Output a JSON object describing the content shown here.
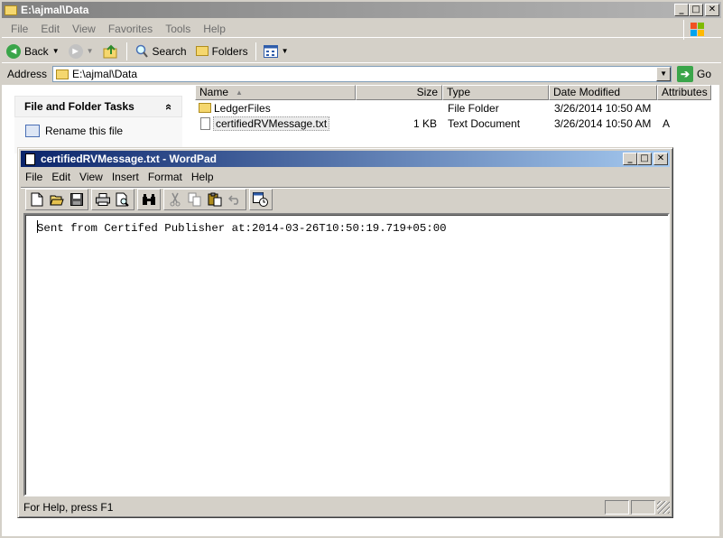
{
  "explorer": {
    "title": "E:\\ajmal\\Data",
    "window_buttons": [
      "_",
      "□",
      "✕"
    ],
    "menu": [
      "File",
      "Edit",
      "View",
      "Favorites",
      "Tools",
      "Help"
    ],
    "toolbar": {
      "back": "Back",
      "search": "Search",
      "folders": "Folders"
    },
    "address": {
      "label": "Address",
      "value": "E:\\ajmal\\Data",
      "go": "Go"
    },
    "tasks": {
      "header": "File and Folder Tasks",
      "collapse": "«",
      "rename": "Rename this file"
    },
    "columns": [
      "Name",
      "Size",
      "Type",
      "Date Modified",
      "Attributes"
    ],
    "files": [
      {
        "name": "LedgerFiles",
        "size": "",
        "type": "File Folder",
        "modified": "3/26/2014 10:50 AM",
        "attributes": ""
      },
      {
        "name": "certifiedRVMessage.txt",
        "size": "1 KB",
        "type": "Text Document",
        "modified": "3/26/2014 10:50 AM",
        "attributes": "A"
      }
    ]
  },
  "wordpad": {
    "title": "certifiedRVMessage.txt - WordPad",
    "menu": [
      "File",
      "Edit",
      "View",
      "Insert",
      "Format",
      "Help"
    ],
    "content": "Sent from Certifed Publisher at:2014-03-26T10:50:19.719+05:00",
    "status": "For Help, press F1"
  }
}
